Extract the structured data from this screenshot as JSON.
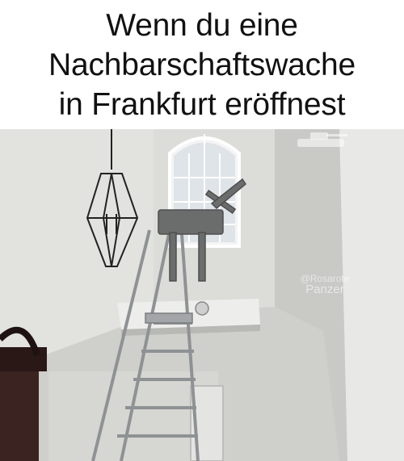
{
  "caption": {
    "lines": [
      "Wenn du eine",
      "Nachbarschaftswache",
      "in Frankfurt eröffnest"
    ]
  },
  "watermark": {
    "handle": "@Rosarote",
    "name": "Panzer",
    "icon": "tank-icon"
  },
  "colors": {
    "background": "#ffffff",
    "caption_text": "#111111",
    "wall": "#d9d9d6",
    "ladder": "#8f9294",
    "gun": "#6b6c6c"
  }
}
